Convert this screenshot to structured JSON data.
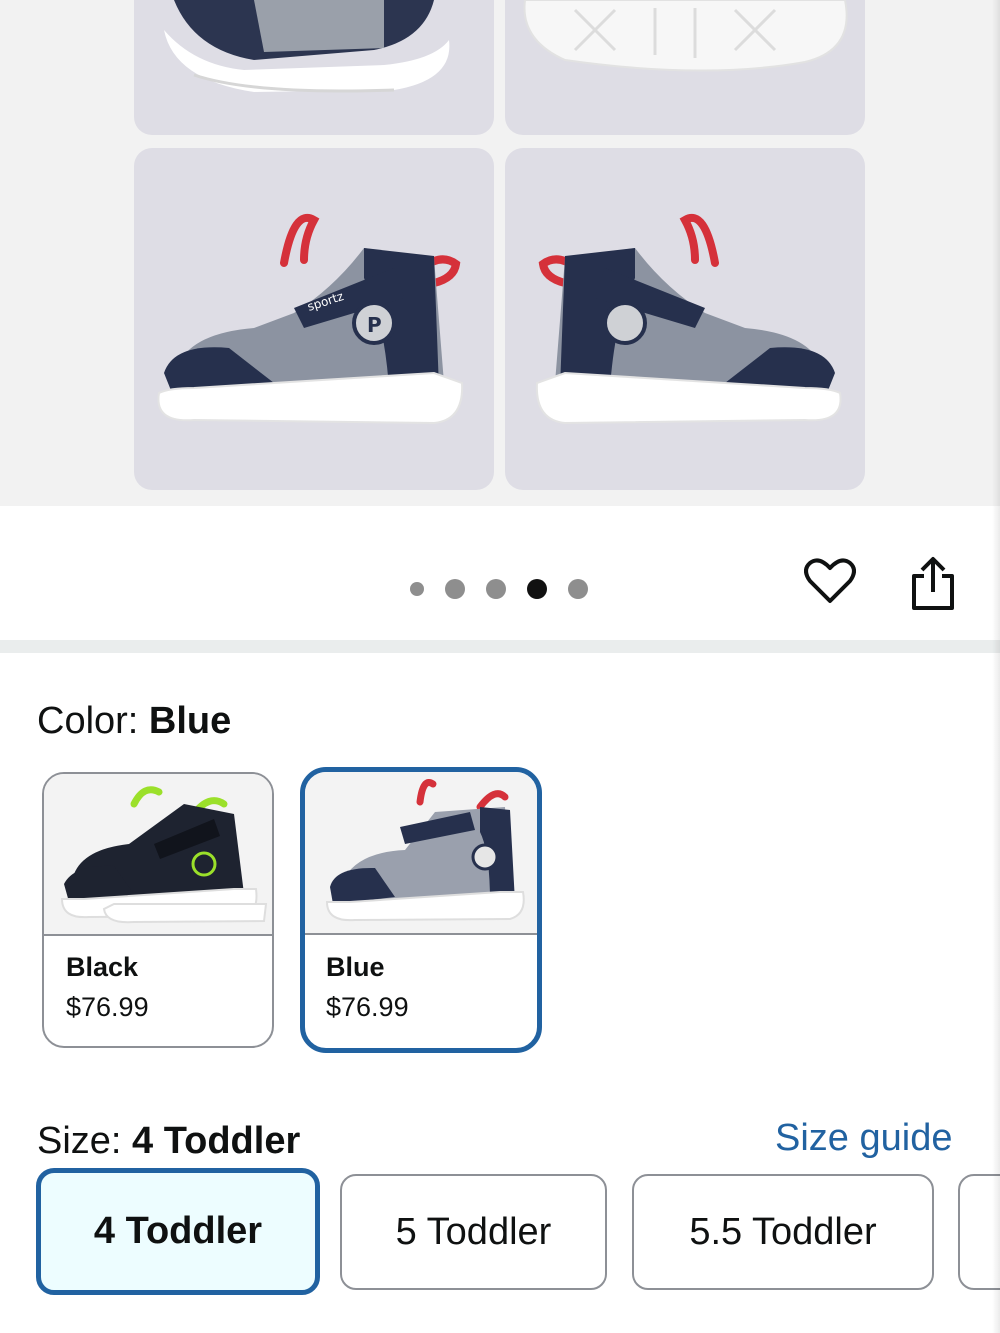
{
  "gallery": {
    "images": [
      "shoe-side-detail",
      "shoe-sole",
      "shoe-left-view",
      "shoe-right-view"
    ],
    "pagination": {
      "count": 5,
      "active_index": 3
    }
  },
  "actions": {
    "favorite_icon": "heart-icon",
    "share_icon": "share-icon"
  },
  "color": {
    "label": "Color:",
    "selected": "Blue",
    "options": [
      {
        "name": "Black",
        "price": "$76.99"
      },
      {
        "name": "Blue",
        "price": "$76.99"
      }
    ]
  },
  "size": {
    "label": "Size:",
    "selected": "4 Toddler",
    "guide_link": "Size guide",
    "options": [
      "4 Toddler",
      "5 Toddler",
      "5.5 Toddler"
    ]
  },
  "colors": {
    "accent": "#2162a1",
    "selected_bg": "#edfdff",
    "tile_bg": "#dedde5"
  }
}
